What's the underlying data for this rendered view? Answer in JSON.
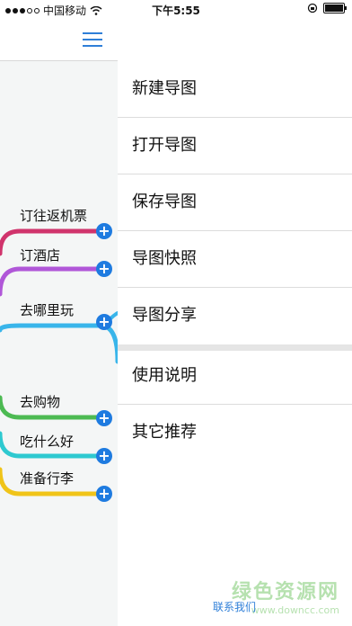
{
  "status_bar": {
    "carrier": "中国移动",
    "time": "下午5:55"
  },
  "mindmap": {
    "nodes": [
      {
        "label": "订往返机票",
        "color": "#d0346c"
      },
      {
        "label": "订酒店",
        "color": "#b057d8"
      },
      {
        "label": "去哪里玩",
        "color": "#39b5ea"
      },
      {
        "label": "去购物",
        "color": "#4cba52"
      },
      {
        "label": "吃什么好",
        "color": "#2ec9d0"
      },
      {
        "label": "准备行李",
        "color": "#f0c419"
      }
    ],
    "plus_symbol": "+"
  },
  "drawer": {
    "items": [
      {
        "label": "新建导图"
      },
      {
        "label": "打开导图"
      },
      {
        "label": "保存导图"
      },
      {
        "label": "导图快照"
      },
      {
        "label": "导图分享"
      },
      {
        "label": "使用说明"
      },
      {
        "label": "其它推荐"
      }
    ],
    "contact_label": "联系我们"
  },
  "watermark": {
    "text": "绿色资源网",
    "url": "www.downcc.com"
  },
  "colors": {
    "accent": "#1e7be0",
    "separator": "#dcdcdc"
  }
}
